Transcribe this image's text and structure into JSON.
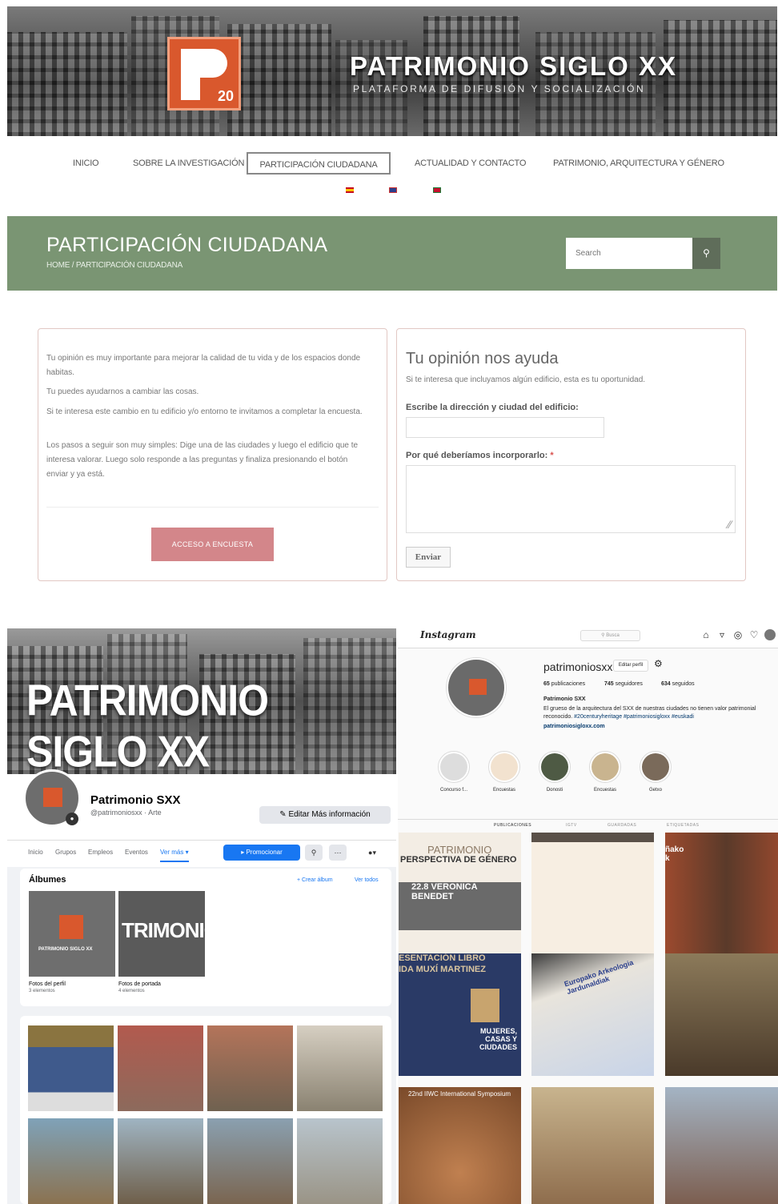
{
  "website": {
    "hero": {
      "logo_number": "20",
      "title": "PATRIMONIO SIGLO XX",
      "subtitle": "PLATAFORMA DE DIFUSIÓN Y SOCIALIZACIÓN"
    },
    "nav": [
      "INICIO",
      "SOBRE LA INVESTIGACIÓN",
      "PARTICIPACIÓN CIUDADANA",
      "ACTUALIDAD Y CONTACTO",
      "PATRIMONIO, ARQUITECTURA Y GÉNERO"
    ],
    "nav_active": "PARTICIPACIÓN CIUDADANA",
    "languages": [
      "es-flag-icon",
      "uk-flag-icon",
      "eu-flag-icon"
    ],
    "page_title": "PARTICIPACIÓN CIUDADANA",
    "breadcrumb": "HOME / PARTICIPACIÓN CIUDADANA",
    "search_placeholder": "Search",
    "left_card": {
      "p1": "Tu opinión es muy importante para mejorar la calidad de tu vida y de los espacios donde habitas.",
      "p2": "Tu puedes ayudarnos a cambiar las cosas.",
      "p3": "Si te interesa este cambio en tu edificio y/o entorno te invitamos a completar la encuesta.",
      "p4": "Los pasos a seguir son muy simples: Dige una de las ciudades y luego el edificio que te interesa valorar. Luego solo responde a las preguntas y finaliza presionando el botón enviar y ya está.",
      "button": "ACCESO A ENCUESTA"
    },
    "right_card": {
      "title": "Tu opinión nos ayuda",
      "subtitle": "Si te interesa que incluyamos algún edificio, esta es tu oportunidad.",
      "label_address": "Escribe la dirección y ciudad del edificio:",
      "label_reason": "Por qué deberíamos incorporarlo:",
      "required_mark": "*",
      "submit": "Enviar"
    },
    "colors": {
      "band": "#7a9573",
      "survey_button": "#d3868a",
      "logo": "#d9582d"
    }
  },
  "facebook": {
    "cover_title": "PATRIMONIO SIGLO XX",
    "page_name": "Patrimonio SXX",
    "handle": "@patrimoniosxx · Arte",
    "edit_button": "Editar Más información",
    "tabs": [
      "Inicio",
      "Grupos",
      "Empleos",
      "Eventos",
      "Ver más ▾"
    ],
    "promote": "Promocionar",
    "albums_title": "Álbumes",
    "create_album": "+ Crear álbum",
    "see_all": "Ver todos",
    "albums": [
      {
        "name": "Fotos del perfil",
        "count": "3 elementos"
      },
      {
        "name": "Fotos de portada",
        "count": "4 elementos"
      }
    ],
    "album_cover_text": "TRIMONIO",
    "profile_logo_text": "PATRIMONIO SIGLO XX"
  },
  "instagram": {
    "logo": "Instagram",
    "search": "Busca",
    "username": "patrimoniosxx",
    "edit_profile": "Editar perfil",
    "stats": [
      {
        "num": "65",
        "label": "publicaciones"
      },
      {
        "num": "745",
        "label": "seguidores"
      },
      {
        "num": "634",
        "label": "seguidos"
      }
    ],
    "bio_name": "Patrimonio SXX",
    "bio_text": "El grueso de la arquitectura del SXX de nuestras ciudades no tienen valor patrimonial reconocido.",
    "bio_tags": "#20centuryheritage #patrimoniosigloxx #euskadi",
    "website": "patrimoniosigloxx.com",
    "highlights": [
      "Concurso f...",
      "Encuestas",
      "Donosti",
      "Encuestas",
      "Getxo"
    ],
    "tabs": [
      "PUBLICACIONES",
      "IGTV",
      "GUARDADAS",
      "ETIQUETADAS"
    ],
    "posts": {
      "p1_title": "PATRIMONIO",
      "p1_sub": "PERSPECTIVA DE GÉNERO",
      "p1_date": "22.8 VERONICA BENEDET",
      "p4_line1": "ESENTACIÓN LIBRO",
      "p4_line2": "IDA MUXÍ MARTINEZ",
      "p4_caption": "MUJERES, CASAS Y CIUDADES",
      "p7_title": "22nd IIWC International Symposium",
      "p5_title": "Europako Arkeologia Jardunaldiak",
      "p3_text": "ñako k"
    }
  }
}
